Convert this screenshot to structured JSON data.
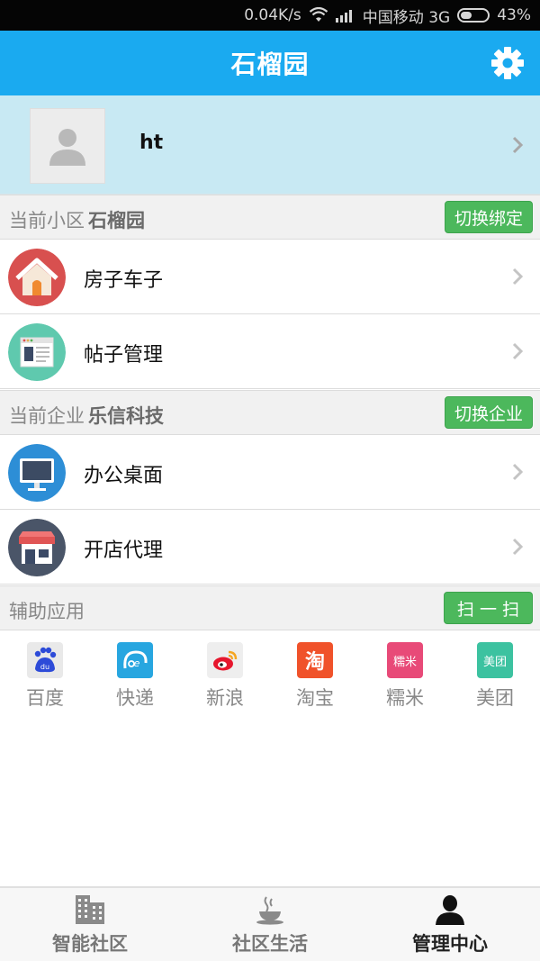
{
  "status_bar": {
    "speed": "0.04K/s",
    "carrier": "中国移动 3G",
    "battery": "43%",
    "battery_level": 0.43,
    "icons": [
      "wifi-icon",
      "signal-icon",
      "battery-icon"
    ]
  },
  "header": {
    "title": "石榴园",
    "settings_icon": "gear-icon"
  },
  "profile": {
    "username": "ht",
    "avatar_icon": "person-icon"
  },
  "community_section": {
    "label": "当前小区",
    "value": "石榴园",
    "button": "切换绑定"
  },
  "community_items": [
    {
      "label": "房子车子",
      "icon": "house-icon",
      "color": "#d8504f"
    },
    {
      "label": "帖子管理",
      "icon": "webpage-icon",
      "color": "#5fc9ae"
    }
  ],
  "enterprise_section": {
    "label": "当前企业",
    "value": "乐信科技",
    "button": "切换企业"
  },
  "enterprise_items": [
    {
      "label": "办公桌面",
      "icon": "monitor-icon",
      "color": "#2d8ed6"
    },
    {
      "label": "开店代理",
      "icon": "storefront-icon",
      "color": "#4a5568"
    }
  ],
  "aux_section": {
    "label": "辅助应用",
    "button": "扫 一 扫"
  },
  "apps": [
    {
      "label": "百度",
      "icon": "baidu-icon",
      "color": "#2d4bd8"
    },
    {
      "label": "快递",
      "icon": "kuaidi-icon",
      "color": "#27a6e0"
    },
    {
      "label": "新浪",
      "icon": "weibo-icon",
      "color": "#e6162d"
    },
    {
      "label": "淘宝",
      "icon": "taobao-icon",
      "color": "#f0522a"
    },
    {
      "label": "糯米",
      "icon": "nuomi-icon",
      "color": "#e84a78",
      "icon_text": "糯米"
    },
    {
      "label": "美团",
      "icon": "meituan-icon",
      "color": "#3cc2a0",
      "icon_text": "美团"
    }
  ],
  "bottom_nav": [
    {
      "label": "智能社区",
      "icon": "buildings-icon",
      "active": false
    },
    {
      "label": "社区生活",
      "icon": "coffee-cup-icon",
      "active": false
    },
    {
      "label": "管理中心",
      "icon": "user-icon",
      "active": true
    }
  ],
  "colors": {
    "primary": "#1aaaf0",
    "profile_bg": "#c8e9f3",
    "button_green": "#4cb85c",
    "section_bg": "#f1f1f1"
  }
}
